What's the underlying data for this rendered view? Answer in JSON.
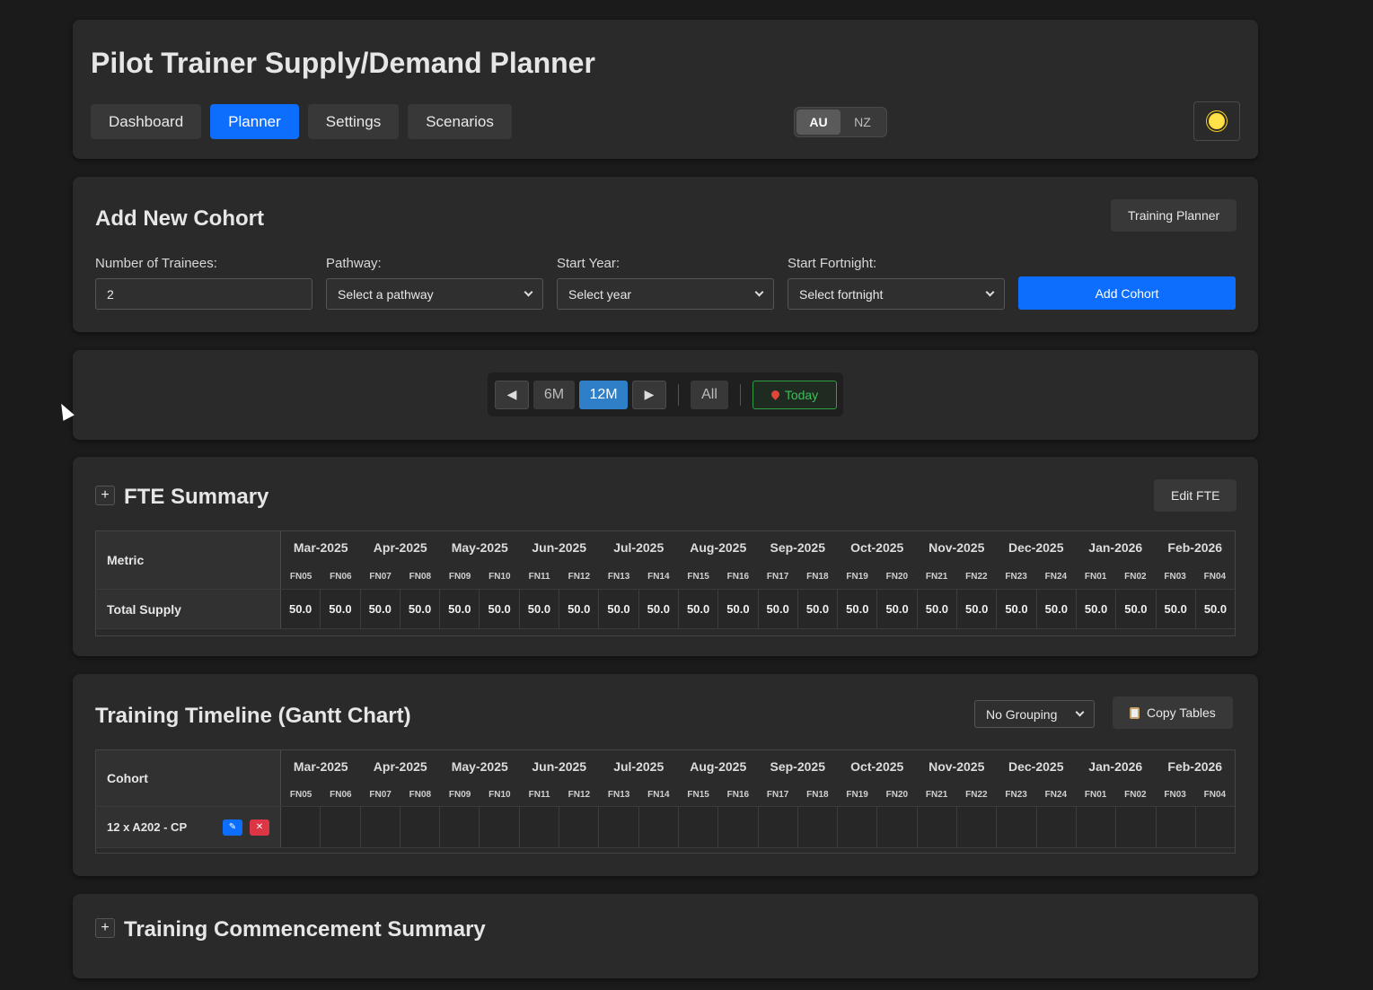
{
  "app": {
    "title": "Pilot Trainer Supply/Demand Planner"
  },
  "nav": {
    "tabs": [
      {
        "label": "Dashboard"
      },
      {
        "label": "Planner"
      },
      {
        "label": "Settings"
      },
      {
        "label": "Scenarios"
      }
    ],
    "active_tab": "Planner"
  },
  "region": {
    "options": [
      "AU",
      "NZ"
    ],
    "selected": "AU"
  },
  "theme_toggle": {
    "icon": "sun-icon"
  },
  "cohort_form": {
    "title": "Add New Cohort",
    "training_planner_label": "Training Planner",
    "trainees_label": "Number of Trainees:",
    "trainees_value": "2",
    "pathway_label": "Pathway:",
    "pathway_value": "Select a pathway",
    "year_label": "Start Year:",
    "year_value": "Select year",
    "fortnight_label": "Start Fortnight:",
    "fortnight_value": "Select fortnight",
    "add_button": "Add Cohort"
  },
  "range": {
    "prev": "◀",
    "six_month": "6M",
    "twelve_month": "12M",
    "next": "▶",
    "all": "All",
    "today": "Today",
    "selected": "12M"
  },
  "months": [
    "Mar-2025",
    "Apr-2025",
    "May-2025",
    "Jun-2025",
    "Jul-2025",
    "Aug-2025",
    "Sep-2025",
    "Oct-2025",
    "Nov-2025",
    "Dec-2025",
    "Jan-2026",
    "Feb-2026"
  ],
  "fortnights": [
    "FN05",
    "FN06",
    "FN07",
    "FN08",
    "FN09",
    "FN10",
    "FN11",
    "FN12",
    "FN13",
    "FN14",
    "FN15",
    "FN16",
    "FN17",
    "FN18",
    "FN19",
    "FN20",
    "FN21",
    "FN22",
    "FN23",
    "FN24",
    "FN01",
    "FN02",
    "FN03",
    "FN04"
  ],
  "fte": {
    "title": "FTE Summary",
    "toggle": "+",
    "edit_label": "Edit FTE",
    "header": "Metric",
    "rows": [
      {
        "label": "Total Supply",
        "values": [
          "50.0",
          "50.0",
          "50.0",
          "50.0",
          "50.0",
          "50.0",
          "50.0",
          "50.0",
          "50.0",
          "50.0",
          "50.0",
          "50.0",
          "50.0",
          "50.0",
          "50.0",
          "50.0",
          "50.0",
          "50.0",
          "50.0",
          "50.0",
          "50.0",
          "50.0",
          "50.0",
          "50.0"
        ]
      }
    ]
  },
  "gantt": {
    "title": "Training Timeline (Gantt Chart)",
    "grouping_value": "No Grouping",
    "copy_label": "Copy Tables",
    "header": "Cohort",
    "rows": [
      {
        "label": "12 x A202 - CP",
        "edit": "✎",
        "delete": "✕"
      }
    ]
  },
  "commencement": {
    "title": "Training Commencement Summary",
    "toggle": "+"
  }
}
